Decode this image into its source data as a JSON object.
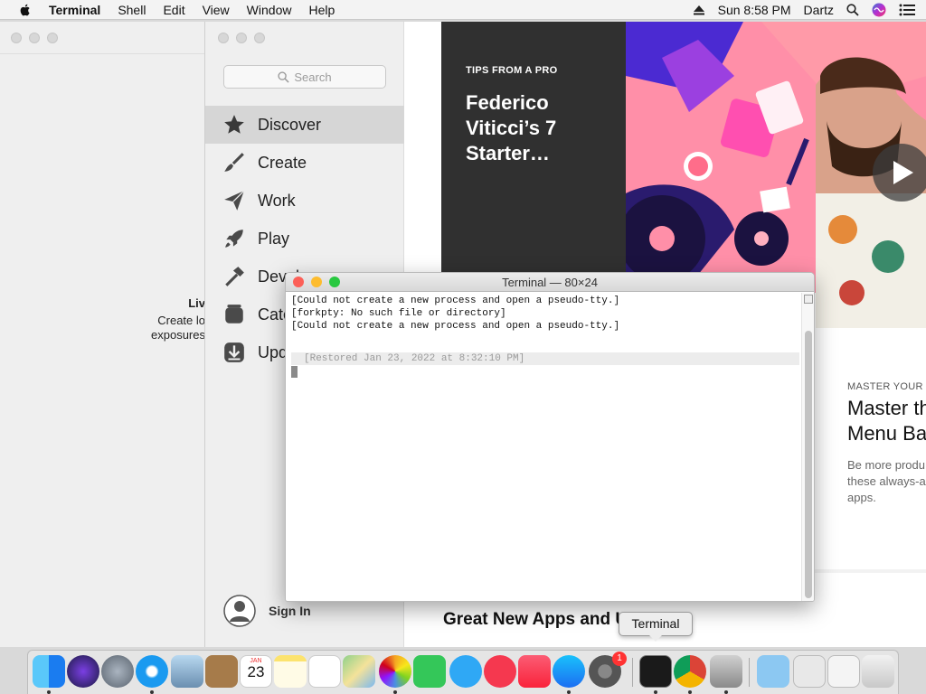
{
  "menubar": {
    "app_name": "Terminal",
    "menus": [
      "Shell",
      "Edit",
      "View",
      "Window",
      "Help"
    ],
    "clock": "Sun 8:58 PM",
    "user": "Dartz",
    "icons": [
      "apple-icon",
      "eject-icon",
      "spotlight-icon",
      "siri-icon",
      "notification-center-icon"
    ]
  },
  "left_window": {
    "heading": "Liv",
    "line1": "Create lo",
    "line2": "exposures"
  },
  "appstore": {
    "search_placeholder": "Search",
    "nav": [
      {
        "label": "Discover",
        "icon": "star-icon"
      },
      {
        "label": "Create",
        "icon": "brush-icon"
      },
      {
        "label": "Work",
        "icon": "paper-plane-icon"
      },
      {
        "label": "Play",
        "icon": "rocket-icon"
      },
      {
        "label": "Devel",
        "icon": "hammer-icon"
      },
      {
        "label": "Cate",
        "icon": "layers-icon"
      },
      {
        "label": "Upd",
        "icon": "download-icon"
      }
    ],
    "sign_in": "Sign In",
    "hero": {
      "kicker": "TIPS FROM A PRO",
      "title": "Federico Viticci’s 7 Starter…"
    },
    "card2": {
      "kicker": "MASTER YOUR M",
      "title_line1": "Master th",
      "title_line2": "Menu Ba",
      "desc_line1": "Be more produ",
      "desc_line2": "these always-a",
      "desc_line3": "apps."
    },
    "section_title": "Great New Apps and U"
  },
  "terminal": {
    "title": "Terminal — 80×24",
    "lines": [
      "[Could not create a new process and open a pseudo-tty.]",
      "[forkpty: No such file or directory]",
      "[Could not create a new process and open a pseudo-tty.]"
    ],
    "restored": "[Restored Jan 23, 2022 at 8:32:10 PM]"
  },
  "tooltip": "Terminal",
  "dock": {
    "calendar_month": "JAN",
    "calendar_day": "23",
    "badge_count": "1",
    "apps": [
      "finder",
      "siri",
      "launchpad",
      "safari",
      "preview",
      "notes-book",
      "calendar",
      "notes",
      "reminders",
      "maps",
      "photos",
      "facetime",
      "messages",
      "news",
      "music",
      "app-store",
      "system-preferences",
      "terminal",
      "chrome",
      "utility",
      "downloads",
      "preview-docs",
      "trash"
    ]
  }
}
